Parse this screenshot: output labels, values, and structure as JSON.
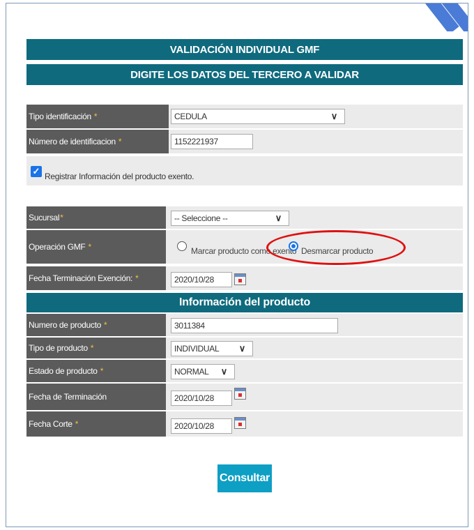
{
  "headers": {
    "title": "VALIDACIÓN INDIVIDUAL GMF",
    "subtitle": "DIGITE LOS DATOS DEL TERCERO A VALIDAR",
    "product_section": "Información del producto"
  },
  "third_party": {
    "tipo_id": {
      "label": "Tipo identificación",
      "required": "*",
      "value": "CEDULA"
    },
    "numero_id": {
      "label": "Número de identificacion",
      "required": "*",
      "value": "1152221937"
    },
    "register_checkbox": {
      "label": "Registrar Información del producto exento.",
      "checked": true
    }
  },
  "operation": {
    "sucursal": {
      "label": "Sucursal",
      "required": "*",
      "value": "-- Seleccione --"
    },
    "operacion": {
      "label": "Operación GMF",
      "required": "*",
      "options": [
        "Marcar producto como exento",
        "Desmarcar producto"
      ],
      "selected": "Desmarcar producto"
    },
    "fecha_terminacion_exencion": {
      "label": "Fecha Terminación Exención:",
      "required": "*",
      "value": "2020/10/28"
    }
  },
  "product": {
    "numero": {
      "label": "Numero de producto",
      "required": "*",
      "value": "3011384"
    },
    "tipo": {
      "label": "Tipo de producto",
      "required": "*",
      "value": "INDIVIDUAL"
    },
    "estado": {
      "label": "Estado de producto",
      "required": "*",
      "value": "NORMAL"
    },
    "fecha_terminacion": {
      "label": "Fecha de Terminación",
      "value": "2020/10/28"
    },
    "fecha_corte": {
      "label": "Fecha Corte",
      "required": "*",
      "value": "2020/10/28"
    }
  },
  "actions": {
    "submit_label": "Consultar"
  },
  "colors": {
    "header": "#0f6a7e",
    "label_bg": "#5b5b5b",
    "button": "#0e9fc4",
    "highlight": "#e01010"
  }
}
